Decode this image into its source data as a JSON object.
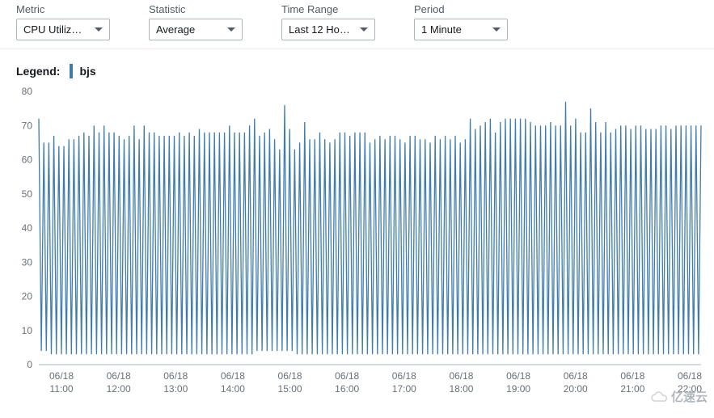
{
  "controls": {
    "metric": {
      "label": "Metric",
      "value": "CPU Utiliz…"
    },
    "statistic": {
      "label": "Statistic",
      "value": "Average"
    },
    "timerange": {
      "label": "Time Range",
      "value": "Last 12 Ho…"
    },
    "period": {
      "label": "Period",
      "value": "1 Minute"
    }
  },
  "legend": {
    "title": "Legend:",
    "series_name": "bjs",
    "series_color": "#3f7cac"
  },
  "watermark_text": "亿速云",
  "chart_data": {
    "type": "line",
    "title": "",
    "xlabel": "",
    "ylabel": "",
    "ylim": [
      0,
      80
    ],
    "yticks": [
      0,
      10,
      20,
      30,
      40,
      50,
      60,
      70,
      80
    ],
    "x_tick_labels": [
      {
        "date": "06/18",
        "time": "11:00"
      },
      {
        "date": "06/18",
        "time": "12:00"
      },
      {
        "date": "06/18",
        "time": "13:00"
      },
      {
        "date": "06/18",
        "time": "14:00"
      },
      {
        "date": "06/18",
        "time": "15:00"
      },
      {
        "date": "06/18",
        "time": "16:00"
      },
      {
        "date": "06/18",
        "time": "17:00"
      },
      {
        "date": "06/18",
        "time": "18:00"
      },
      {
        "date": "06/18",
        "time": "19:00"
      },
      {
        "date": "06/18",
        "time": "20:00"
      },
      {
        "date": "06/18",
        "time": "21:00"
      },
      {
        "date": "06/18",
        "time": "22:00"
      }
    ],
    "series": [
      {
        "name": "bjs",
        "color": "#3f7cac",
        "values": [
          72,
          4,
          65,
          4,
          65,
          3,
          67,
          3,
          64,
          3,
          64,
          3,
          66,
          3,
          66,
          3,
          67,
          3,
          68,
          3,
          67,
          3,
          70,
          3,
          68,
          3,
          70,
          3,
          68,
          3,
          68,
          3,
          67,
          3,
          66,
          3,
          67,
          3,
          70,
          3,
          66,
          3,
          70,
          3,
          68,
          3,
          68,
          3,
          67,
          3,
          67,
          3,
          67,
          3,
          67,
          3,
          68,
          3,
          67,
          3,
          68,
          3,
          67,
          3,
          69,
          3,
          68,
          3,
          68,
          3,
          68,
          3,
          68,
          3,
          68,
          3,
          70,
          3,
          68,
          3,
          68,
          3,
          68,
          3,
          70,
          3,
          72,
          4,
          67,
          4,
          68,
          4,
          69,
          4,
          66,
          4,
          63,
          4,
          76,
          4,
          69,
          4,
          63,
          3,
          65,
          3,
          71,
          3,
          66,
          3,
          66,
          3,
          68,
          3,
          66,
          3,
          65,
          3,
          66,
          3,
          68,
          3,
          68,
          3,
          67,
          3,
          68,
          3,
          68,
          3,
          68,
          3,
          65,
          3,
          66,
          3,
          67,
          3,
          66,
          3,
          67,
          3,
          67,
          3,
          66,
          3,
          65,
          3,
          67,
          3,
          67,
          3,
          66,
          3,
          66,
          3,
          65,
          3,
          67,
          3,
          66,
          3,
          67,
          3,
          66,
          3,
          67,
          3,
          65,
          3,
          66,
          3,
          72,
          3,
          69,
          3,
          70,
          3,
          71,
          3,
          72,
          3,
          68,
          3,
          71,
          3,
          72,
          3,
          72,
          3,
          72,
          3,
          72,
          3,
          72,
          3,
          71,
          3,
          70,
          3,
          70,
          3,
          70,
          3,
          71,
          3,
          70,
          3,
          70,
          3,
          77,
          3,
          70,
          3,
          72,
          3,
          68,
          3,
          68,
          3,
          75,
          3,
          71,
          3,
          68,
          3,
          71,
          3,
          68,
          3,
          69,
          3,
          70,
          3,
          70,
          3,
          69,
          3,
          70,
          3,
          70,
          3,
          69,
          3,
          69,
          3,
          69,
          3,
          70,
          3,
          70,
          3,
          69,
          3,
          70,
          3,
          70,
          3,
          70,
          3,
          70,
          3,
          70,
          3,
          70
        ]
      }
    ]
  }
}
